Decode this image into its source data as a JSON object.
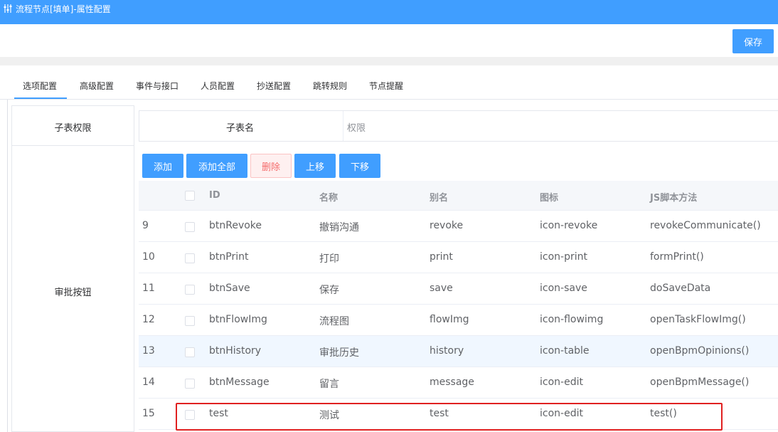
{
  "window": {
    "title": "流程节点[填单]-属性配置"
  },
  "toolbar": {
    "save_label": "保存"
  },
  "tabs": [
    {
      "label": "选项配置"
    },
    {
      "label": "高级配置"
    },
    {
      "label": "事件与接口"
    },
    {
      "label": "人员配置"
    },
    {
      "label": "抄送配置"
    },
    {
      "label": "跳转规则"
    },
    {
      "label": "节点提醒"
    }
  ],
  "subtable": {
    "label": "子表权限",
    "col_name": "子表名",
    "col_perm": "权限"
  },
  "buttons_section": {
    "label": "审批按钮",
    "actions": {
      "add": "添加",
      "add_all": "添加全部",
      "delete": "删除",
      "up": "上移",
      "down": "下移"
    },
    "columns": {
      "id": "ID",
      "name": "名称",
      "alias": "别名",
      "icon": "图标",
      "js": "JS脚本方法"
    },
    "rows": [
      {
        "no": "9",
        "id": "btnRevoke",
        "name": "撤销沟通",
        "alias": "revoke",
        "icon": "icon-revoke",
        "js": "revokeCommunicate()"
      },
      {
        "no": "10",
        "id": "btnPrint",
        "name": "打印",
        "alias": "print",
        "icon": "icon-print",
        "js": "formPrint()"
      },
      {
        "no": "11",
        "id": "btnSave",
        "name": "保存",
        "alias": "save",
        "icon": "icon-save",
        "js": "doSaveData"
      },
      {
        "no": "12",
        "id": "btnFlowImg",
        "name": "流程图",
        "alias": "flowImg",
        "icon": "icon-flowimg",
        "js": "openTaskFlowImg()"
      },
      {
        "no": "13",
        "id": "btnHistory",
        "name": "审批历史",
        "alias": "history",
        "icon": "icon-table",
        "js": "openBpmOpinions()"
      },
      {
        "no": "14",
        "id": "btnMessage",
        "name": "留言",
        "alias": "message",
        "icon": "icon-edit",
        "js": "openBpmMessage()"
      },
      {
        "no": "15",
        "id": "test",
        "name": "测试",
        "alias": "test",
        "icon": "icon-edit",
        "js": "test()"
      }
    ]
  }
}
